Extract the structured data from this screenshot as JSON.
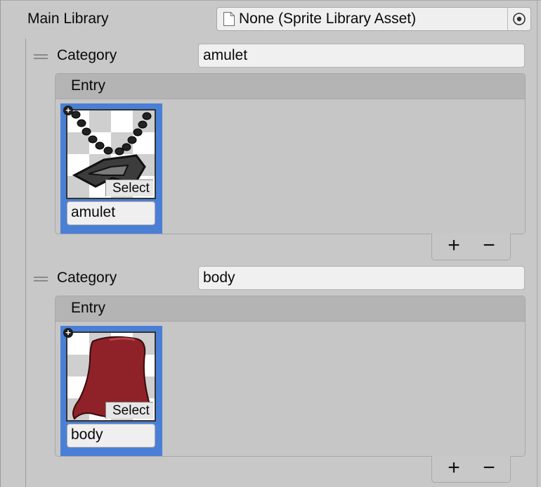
{
  "main_library": {
    "label": "Main Library",
    "value": "None (Sprite Library Asset)",
    "icon_left": "document-icon",
    "icon_right": "object-picker-icon"
  },
  "categories": [
    {
      "label": "Category",
      "name": "amulet",
      "entry_header": "Entry",
      "entries": [
        {
          "name": "amulet",
          "select_label": "Select",
          "thumbnail": "amulet-sprite"
        }
      ],
      "footer": {
        "add_label": "+",
        "remove_label": "−"
      }
    },
    {
      "label": "Category",
      "name": "body",
      "entry_header": "Entry",
      "entries": [
        {
          "name": "body",
          "select_label": "Select",
          "thumbnail": "body-sprite",
          "color": "#8e2228"
        }
      ],
      "footer": {
        "add_label": "+",
        "remove_label": "−"
      }
    }
  ],
  "colors": {
    "selection": "#4a7fd6",
    "background": "#c8c8c8"
  }
}
